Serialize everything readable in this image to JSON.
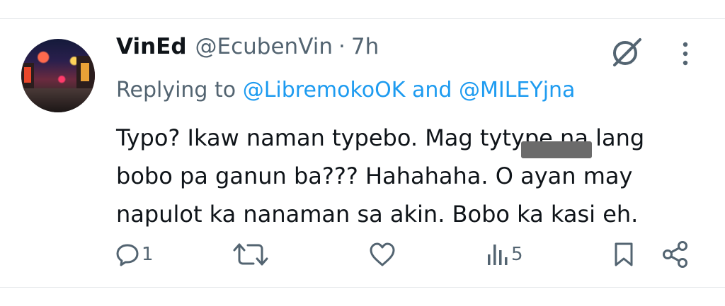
{
  "tweet": {
    "author_name": "VinEd",
    "handle": "@EcubenVin",
    "separator": "·",
    "time": "7h",
    "replying_prefix": "Replying to",
    "mention_1": "@LibremokoOK",
    "joiner": "and",
    "mention_2": "@MILEYjna",
    "body_lines": [
      "Typo? Ikaw naman typebo. Mag tytype na lang",
      "bobo pa ganun ba??? Hahahaha. O ayan may",
      "napulot ka nanaman sa akin. Bobo ka kasi eh."
    ]
  },
  "actions": {
    "reply_count": "1",
    "retweet_count": "",
    "like_count": "",
    "views_count": "5"
  },
  "icons": {
    "reply": "comment-icon",
    "retweet": "retweet-icon",
    "like": "heart-icon",
    "views": "views-chart-icon",
    "bookmark": "bookmark-icon",
    "share": "share-icon",
    "grok": "grok-icon",
    "more": "more-vertical-icon"
  },
  "colors": {
    "text": "#0f1419",
    "secondary": "#536471",
    "accent": "#1d9bf0"
  }
}
